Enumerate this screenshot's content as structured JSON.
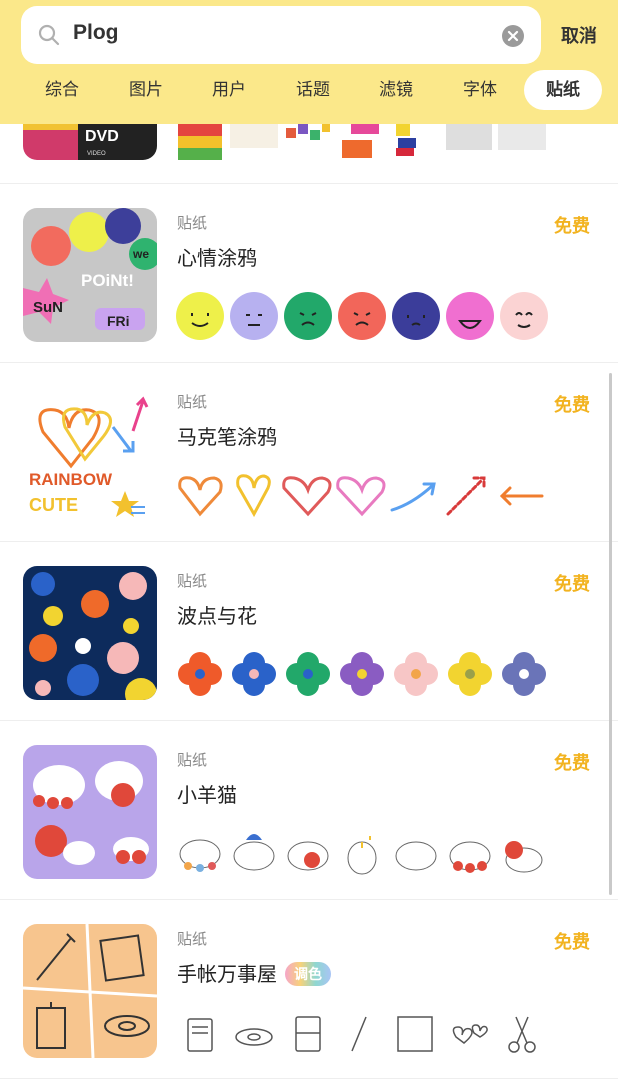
{
  "search": {
    "query": "Plog",
    "cancel_label": "取消"
  },
  "tabs": [
    {
      "label": "综合",
      "active": false
    },
    {
      "label": "图片",
      "active": false
    },
    {
      "label": "用户",
      "active": false
    },
    {
      "label": "话题",
      "active": false
    },
    {
      "label": "滤镜",
      "active": false
    },
    {
      "label": "字体",
      "active": false
    },
    {
      "label": "贴纸",
      "active": true
    }
  ],
  "items": [
    {
      "type": "贴纸",
      "title": "心情涂鸦",
      "price": "免费"
    },
    {
      "type": "贴纸",
      "title": "马克笔涂鸦",
      "price": "免费"
    },
    {
      "type": "贴纸",
      "title": "波点与花",
      "price": "免费"
    },
    {
      "type": "贴纸",
      "title": "小羊猫",
      "price": "免费"
    },
    {
      "type": "贴纸",
      "title": "手帐万事屋",
      "price": "免费",
      "badge": "调色"
    }
  ],
  "thumb_text": {
    "dvd": "DVD",
    "dvd_sub": "VIDEO",
    "mood": [
      "POiNt!",
      "SuN",
      "FRi",
      "we"
    ],
    "rainbow": [
      "RAINBOW",
      "CUTE"
    ]
  },
  "colors": {
    "header_bg": "#fbe88a",
    "accent": "#f2b320"
  }
}
